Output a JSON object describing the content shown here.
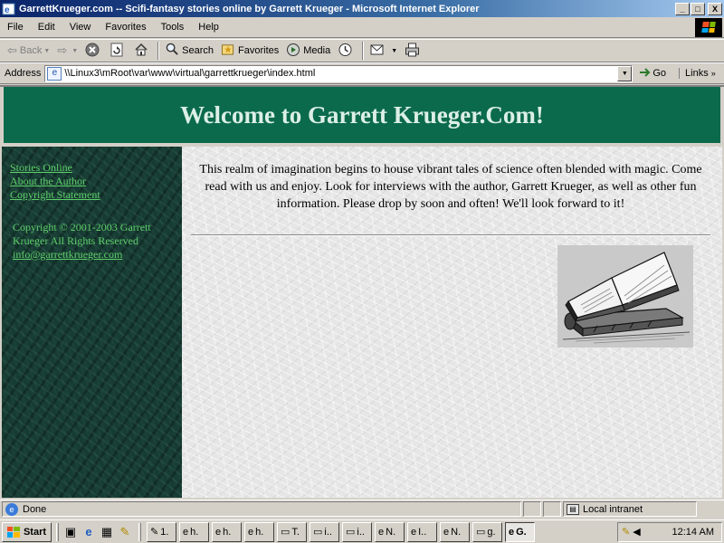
{
  "window": {
    "title": "GarrettKrueger.com -- Scifi-fantasy stories online by Garrett Krueger - Microsoft Internet Explorer",
    "buttons": {
      "minimize": "_",
      "maximize": "□",
      "close": "X"
    }
  },
  "menu": [
    "File",
    "Edit",
    "View",
    "Favorites",
    "Tools",
    "Help"
  ],
  "toolbar": {
    "back": "Back",
    "search": "Search",
    "favorites": "Favorites",
    "media": "Media"
  },
  "address": {
    "label": "Address",
    "url": "\\\\Linux3\\mRoot\\var\\www\\virtual\\garrettkrueger\\index.html",
    "go": "Go",
    "links": "Links"
  },
  "page": {
    "header_title": "Welcome to Garrett Krueger.Com!",
    "nav": [
      "Stories Online",
      "About the Author",
      "Copyright Statement"
    ],
    "copyright": "Copyright © 2001-2003 Garrett Krueger All Rights Reserved",
    "email": "info@garrettkrueger.com",
    "intro": "This realm of imagination begins to house vibrant tales of science often blended with magic. Come read with us and enjoy. Look for interviews with the author, Garrett Krueger, as well as other fun information. Please drop by soon and often! We'll look forward to it!"
  },
  "status": {
    "text": "Done",
    "zone": "Local intranet"
  },
  "taskbar": {
    "start": "Start",
    "tasks": [
      "1.",
      "h.",
      "h.",
      "h.",
      "T.",
      "i..",
      "i..",
      "N.",
      "I..",
      "N.",
      "g.",
      "G."
    ],
    "clock": "12:14 AM"
  },
  "colors": {
    "header_bg": "#0b6a4c",
    "link": "#5fcf6a",
    "sidebar_bg": "#163c33"
  }
}
